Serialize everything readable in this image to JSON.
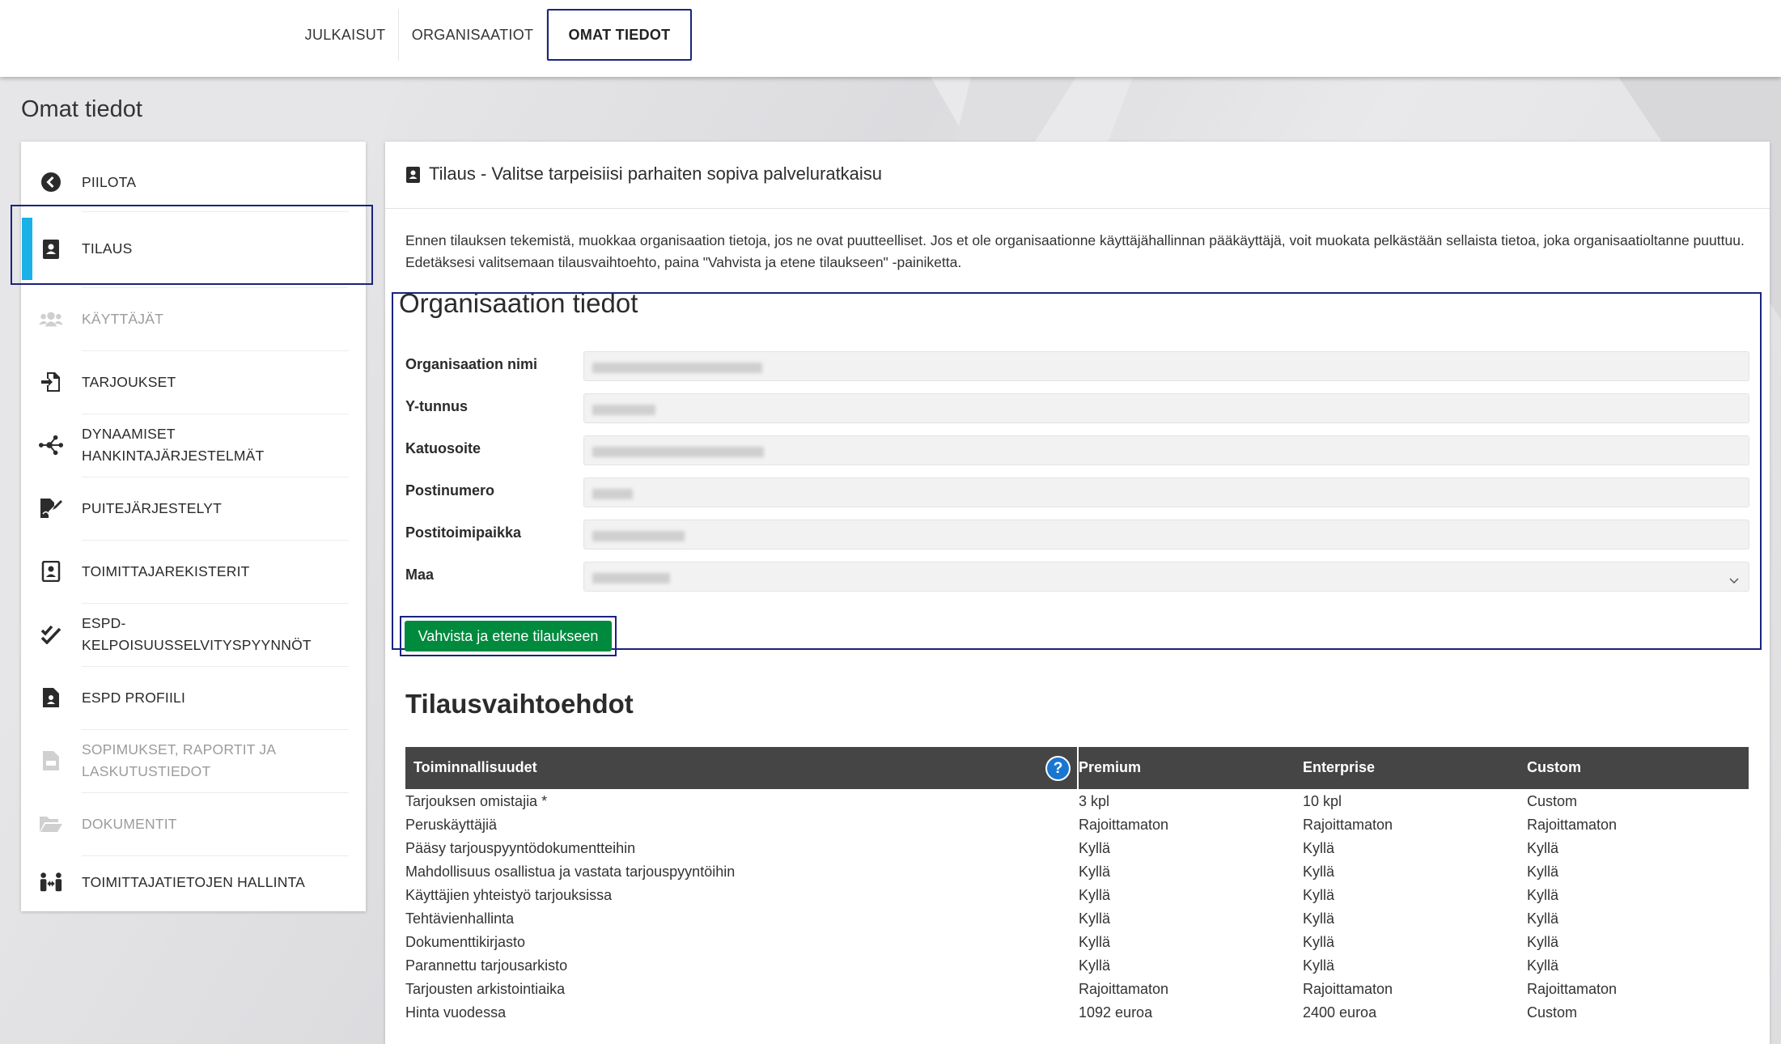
{
  "nav": {
    "tabs": [
      {
        "label": "JULKAISUT"
      },
      {
        "label": "ORGANISAATIOT"
      },
      {
        "label": "OMAT TIEDOT"
      }
    ]
  },
  "page": {
    "title": "Omat tiedot"
  },
  "sidebar": {
    "items": [
      {
        "label": "PIILOTA",
        "icon": "chevron-left-circle-icon"
      },
      {
        "label": "TILAUS",
        "icon": "contact-card-icon"
      },
      {
        "label": "KÄYTTÄJÄT",
        "icon": "users-icon"
      },
      {
        "label": "TARJOUKSET",
        "icon": "file-import-icon"
      },
      {
        "label": "DYNAAMISET HANKINTAJÄRJESTELMÄT",
        "icon": "network-icon"
      },
      {
        "label": "PUITEJÄRJESTELYT",
        "icon": "file-signature-icon"
      },
      {
        "label": "TOIMITTAJAREKISTERIT",
        "icon": "portrait-icon"
      },
      {
        "label": "ESPD-KELPOISUUSSELVITYSPYYNNÖT",
        "icon": "double-check-icon"
      },
      {
        "label": "ESPD PROFIILI",
        "icon": "file-user-icon"
      },
      {
        "label": "SOPIMUKSET, RAPORTIT JA LASKUTUSTIEDOT",
        "icon": "file-invoice-icon"
      },
      {
        "label": "DOKUMENTIT",
        "icon": "folder-open-icon"
      },
      {
        "label": "TOIMITTAJATIETOJEN HALLINTA",
        "icon": "people-arrows-icon"
      }
    ]
  },
  "main": {
    "header": "Tilaus - Valitse tarpeisiisi parhaiten sopiva palveluratkaisu",
    "intro": "Ennen tilauksen tekemistä, muokkaa organisaation tietoja, jos ne ovat puutteelliset. Jos et ole organisaationne käyttäjähallinnan pääkäyttäjä, voit muokata pelkästään sellaista tietoa, joka organisaatioltanne puuttuu. Edetäksesi valitsemaan tilausvaihtoehto, paina \"Vahvista ja etene tilaukseen\" -painiketta.",
    "org": {
      "title": "Organisaation tiedot",
      "fields": [
        {
          "label": "Organisaation nimi"
        },
        {
          "label": "Y-tunnus"
        },
        {
          "label": "Katuosoite"
        },
        {
          "label": "Postinumero"
        },
        {
          "label": "Postitoimipaikka"
        },
        {
          "label": "Maa"
        }
      ],
      "confirm_label": "Vahvista ja etene tilaukseen"
    },
    "plans": {
      "title": "Tilausvaihtoehdot",
      "headers": [
        "Toiminnallisuudet",
        "Premium",
        "Enterprise",
        "Custom"
      ],
      "help": "?",
      "rows": [
        [
          "Tarjouksen omistajia *",
          "3 kpl",
          "10 kpl",
          "Custom"
        ],
        [
          "Peruskäyttäjiä",
          "Rajoittamaton",
          "Rajoittamaton",
          "Rajoittamaton"
        ],
        [
          "Pääsy tarjouspyyntödokumentteihin",
          "Kyllä",
          "Kyllä",
          "Kyllä"
        ],
        [
          "Mahdollisuus osallistua ja vastata tarjouspyyntöihin",
          "Kyllä",
          "Kyllä",
          "Kyllä"
        ],
        [
          "Käyttäjien yhteistyö tarjouksissa",
          "Kyllä",
          "Kyllä",
          "Kyllä"
        ],
        [
          "Tehtävienhallinta",
          "Kyllä",
          "Kyllä",
          "Kyllä"
        ],
        [
          "Dokumenttikirjasto",
          "Kyllä",
          "Kyllä",
          "Kyllä"
        ],
        [
          "Parannettu tarjousarkisto",
          "Kyllä",
          "Kyllä",
          "Kyllä"
        ],
        [
          "Tarjousten arkistointiaika",
          "Rajoittamaton",
          "Rajoittamaton",
          "Rajoittamaton"
        ],
        [
          "Hinta vuodessa",
          "1092 euroa",
          "2400 euroa",
          "Custom"
        ]
      ]
    }
  },
  "colors": {
    "accent_border": "#1a237e",
    "active_bar": "#1ab0e8",
    "confirm_button": "#008a3e",
    "table_header": "#454545",
    "help_icon": "#1976d2"
  }
}
